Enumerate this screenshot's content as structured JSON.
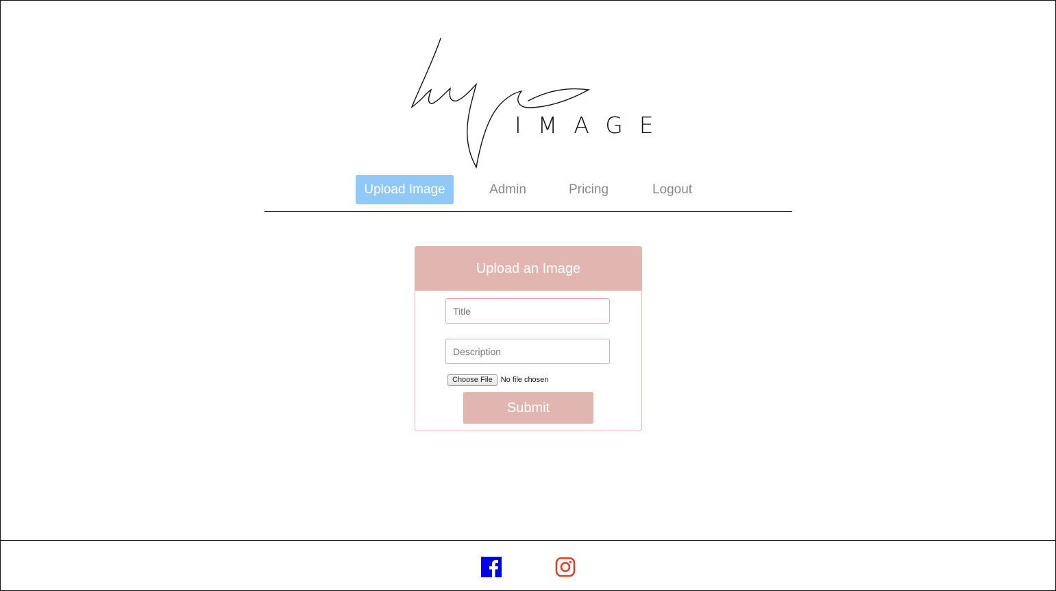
{
  "brand": {
    "wordmark": "IMAGE",
    "colors": {
      "accent_pink": "#e1b6b0",
      "nav_active": "#90c8f8",
      "facebook": "#0000ee",
      "instagram": "#e0402a"
    }
  },
  "nav": {
    "items": [
      {
        "label": "Upload Image",
        "active": true
      },
      {
        "label": "Admin",
        "active": false
      },
      {
        "label": "Pricing",
        "active": false
      },
      {
        "label": "Logout",
        "active": false
      }
    ]
  },
  "upload_form": {
    "heading": "Upload an Image",
    "title_placeholder": "Title",
    "description_placeholder": "Description",
    "file_button_label": "Choose File",
    "file_status": "No file chosen",
    "submit_label": "Submit"
  },
  "footer": {
    "icons": [
      "facebook-icon",
      "instagram-icon"
    ]
  }
}
